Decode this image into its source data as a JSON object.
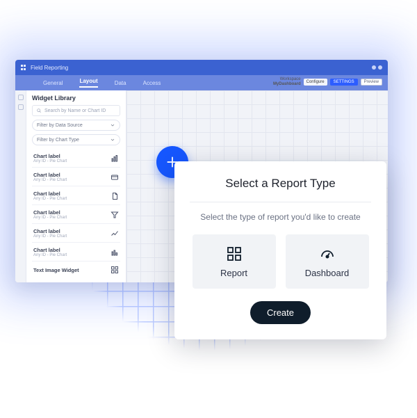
{
  "titlebar": {
    "app_name": "Field Reporting"
  },
  "menubar": {
    "items": [
      "General",
      "Layout",
      "Data",
      "Access"
    ],
    "active_index": 1,
    "workspace_prefix": "Workspace",
    "workspace_name": "MyDashboard",
    "config_label": "Configure",
    "save_label": "SETTINGS",
    "preview_label": "Preview"
  },
  "sidebar": {
    "title": "Widget Library",
    "search_placeholder": "Search by Name or Chart ID",
    "filter1": "Filter by Data Source",
    "filter2": "Filter by Chart Type",
    "items": [
      {
        "label": "Chart label",
        "sub": "Any ID - Pie Chart",
        "icon": "bar"
      },
      {
        "label": "Chart label",
        "sub": "Any ID - Pie Chart",
        "icon": "card"
      },
      {
        "label": "Chart label",
        "sub": "Any ID - Pie Chart",
        "icon": "doc"
      },
      {
        "label": "Chart label",
        "sub": "Any ID - Pie Chart",
        "icon": "funnel"
      },
      {
        "label": "Chart label",
        "sub": "Any ID - Pie Chart",
        "icon": "line"
      },
      {
        "label": "Chart label",
        "sub": "Any ID - Pie Chart",
        "icon": "bar"
      },
      {
        "label": "Text Image Widget",
        "sub": "",
        "icon": "grid"
      }
    ]
  },
  "modal": {
    "title": "Select a Report Type",
    "subtitle": "Select the type of report you'd like to create",
    "option_report": "Report",
    "option_dashboard": "Dashboard",
    "create_label": "Create"
  }
}
